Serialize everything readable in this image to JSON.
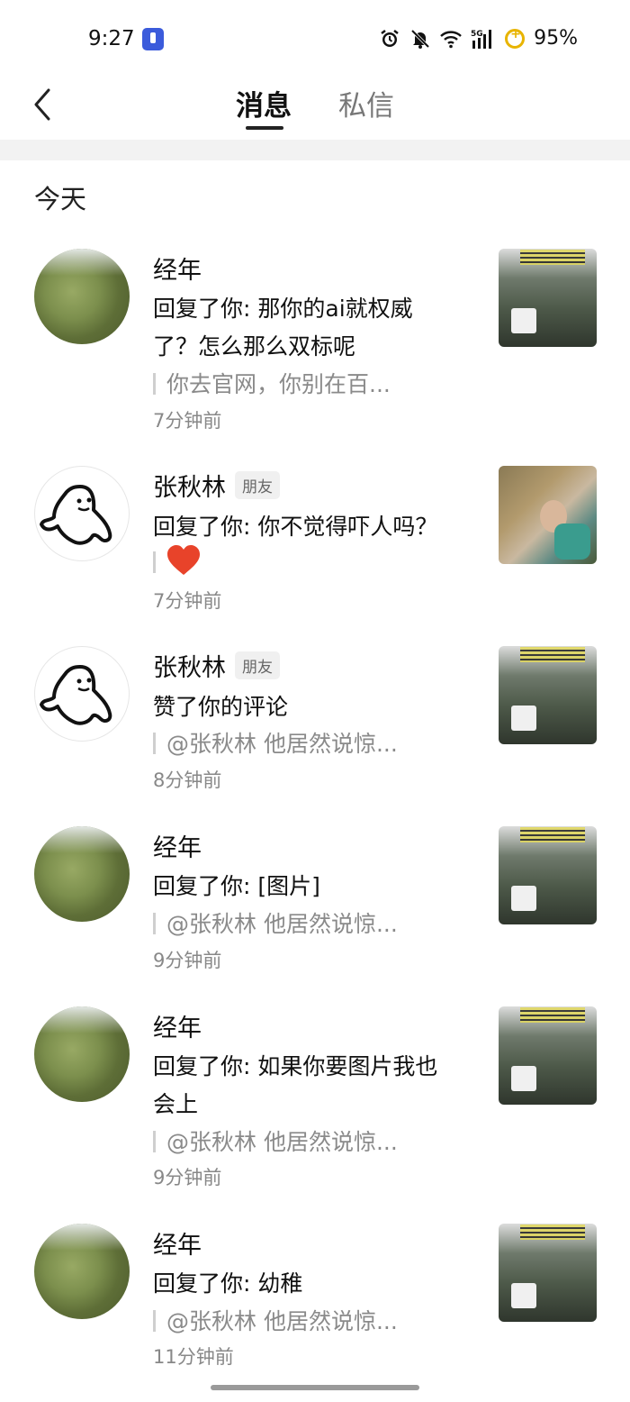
{
  "status_bar": {
    "time": "9:27",
    "network": "5G",
    "battery": "95%"
  },
  "header": {
    "tab_messages": "消息",
    "tab_private": "私信",
    "active_tab": "消息"
  },
  "section": {
    "title": "今天"
  },
  "notifications": [
    {
      "name": "经年",
      "badge": "",
      "lines": [
        "回复了你: 那你的ai就权威",
        "了？怎么那么双标呢"
      ],
      "quote": "你去官网，你别在百...",
      "time": "7分钟前",
      "avatar": "tree-icon",
      "thumbnail": "farm-video-thumbnail"
    },
    {
      "name": "张秋林",
      "badge": "朋友",
      "lines": [
        "回复了你: 你不觉得吓人吗？"
      ],
      "quote": "",
      "quote_emoji": "red-heart",
      "time": "7分钟前",
      "avatar": "ghost-doodle-icon",
      "thumbnail": "people-photo-thumbnail"
    },
    {
      "name": "张秋林",
      "badge": "朋友",
      "lines": [
        "赞了你的评论"
      ],
      "quote": "@张秋林 他居然说惊...",
      "time": "8分钟前",
      "avatar": "ghost-doodle-icon",
      "thumbnail": "farm-video-thumbnail"
    },
    {
      "name": "经年",
      "badge": "",
      "lines": [
        "回复了你: [图片]"
      ],
      "quote": "@张秋林 他居然说惊...",
      "time": "9分钟前",
      "avatar": "tree-icon",
      "thumbnail": "farm-video-thumbnail"
    },
    {
      "name": "经年",
      "badge": "",
      "lines": [
        "回复了你: 如果你要图片我也",
        "会上"
      ],
      "quote": "@张秋林 他居然说惊...",
      "time": "9分钟前",
      "avatar": "tree-icon",
      "thumbnail": "farm-video-thumbnail"
    },
    {
      "name": "经年",
      "badge": "",
      "lines": [
        "回复了你: 幼稚"
      ],
      "quote": "@张秋林 他居然说惊...",
      "time": "11分钟前",
      "avatar": "tree-icon",
      "thumbnail": "farm-video-thumbnail"
    }
  ]
}
